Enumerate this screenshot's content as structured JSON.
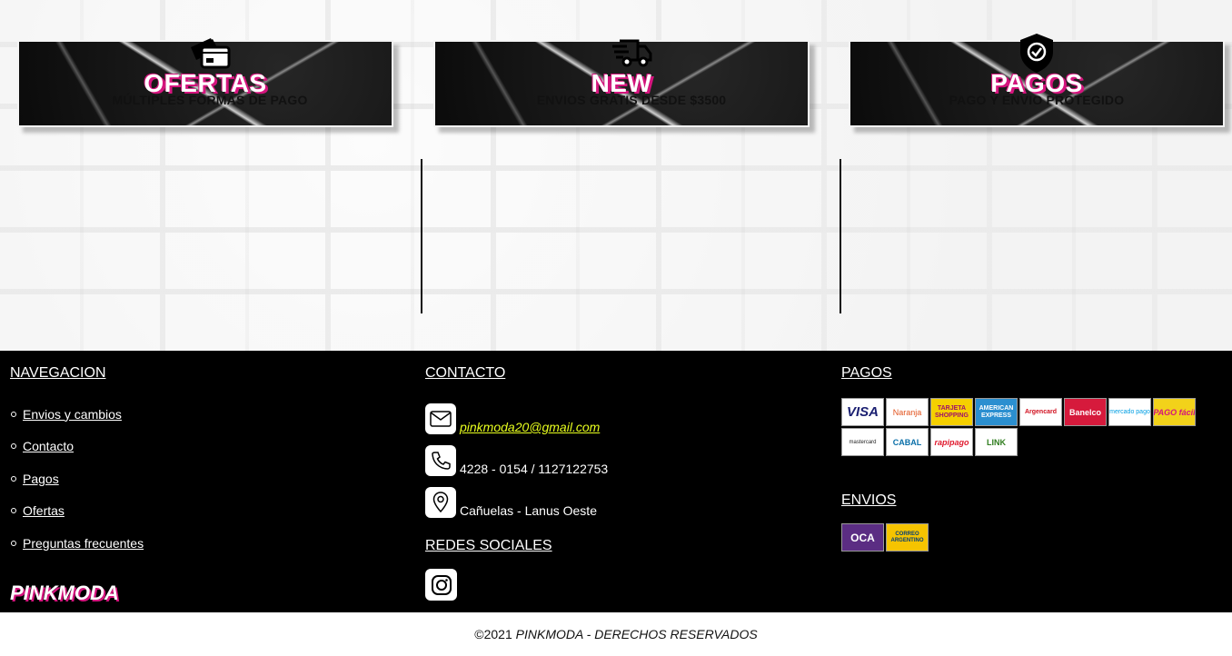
{
  "banners": [
    {
      "label": "OFERTAS"
    },
    {
      "label": "NEW"
    },
    {
      "label": "PAGOS"
    }
  ],
  "features": [
    {
      "icon": "payment-cards-icon",
      "text": "MÚLTIPLES FORMAS DE PAGO"
    },
    {
      "icon": "delivery-truck-icon",
      "text": "ENVIOS GRATIS DESDE $3500"
    },
    {
      "icon": "shield-check-icon",
      "text": "PAGO Y ENVIO PROTEGIDO"
    }
  ],
  "footer": {
    "nav": {
      "title": "NAVEGACION",
      "items": [
        "Envios y cambios",
        "Contacto",
        "Pagos",
        "Ofertas",
        "Preguntas frecuentes"
      ],
      "brand": "PINKMODA"
    },
    "contact": {
      "title": "CONTACTO",
      "email": " pinkmoda20@gmail.com",
      "phone": "4228 - 0154 / 1127122753",
      "location": "Cañuelas - Lanus Oeste",
      "social_title": "REDES SOCIALES"
    },
    "payments": {
      "title": "PAGOS",
      "methods": [
        "VISA",
        "Naranja",
        "TARJETA SHOPPING",
        "AMERICAN EXPRESS",
        "Argencard",
        "Banelco",
        "mercado pago",
        "PAGO fácil",
        "mastercard",
        "CABAL",
        "rapipago",
        "LINK"
      ],
      "shipping_title": "ENVIOS",
      "shipping": [
        "OCA",
        "CORREO ARGENTINO"
      ]
    }
  },
  "copyright": {
    "prefix": "©2021 ",
    "text": "PINKMODA - DERECHOS RESERVADOS"
  },
  "colors": {
    "brand_pink": "#d4147d",
    "email_link": "#e8ff1e",
    "footer_bg": "#000000"
  }
}
